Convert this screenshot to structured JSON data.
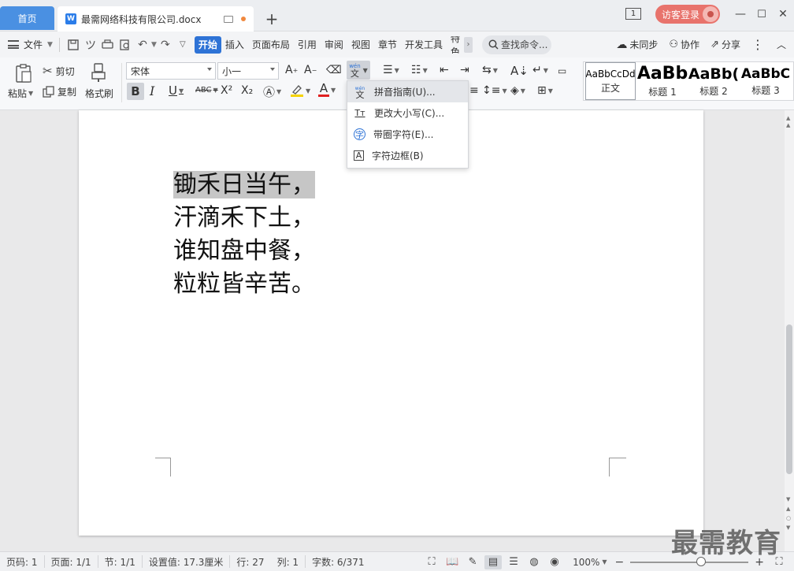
{
  "tabs": {
    "home": "首页",
    "doc_icon": "W",
    "doc_title": "最需网络科技有限公司.docx",
    "add": "+"
  },
  "titlebar": {
    "window_count": "1",
    "login": "访客登录",
    "minimize": "—",
    "maximize": "☐",
    "close": "✕"
  },
  "menubar": {
    "file": "文件",
    "items": [
      "开始",
      "插入",
      "页面布局",
      "引用",
      "审阅",
      "视图",
      "章节",
      "开发工具",
      "特色"
    ],
    "more": "›",
    "search": "查找命令...",
    "sync": "未同步",
    "collab": "协作",
    "share": "分享"
  },
  "ribbon": {
    "paste": "粘贴",
    "cut": "剪切",
    "copy": "复制",
    "format_painter": "格式刷",
    "font_name": "宋体",
    "font_size": "小一",
    "bold": "B",
    "italic": "I",
    "underline": "U",
    "strikethrough": "ABC",
    "superscript": "X²",
    "subscript": "X₂",
    "pinyin": "文"
  },
  "styles": [
    {
      "sample": "AaBbCcDd",
      "name": "正文"
    },
    {
      "sample": "AaBb",
      "name": "标题 1"
    },
    {
      "sample": "AaBb(",
      "name": "标题 2"
    },
    {
      "sample": "AaBbC",
      "name": "标题 3"
    }
  ],
  "dropdown": {
    "items": [
      {
        "label": "拼音指南(U)...",
        "icon": "文"
      },
      {
        "label": "更改大小写(C)...",
        "icon": "Tт"
      },
      {
        "label": "带圈字符(E)...",
        "icon": "字"
      },
      {
        "label": "字符边框(B)",
        "icon": "A"
      }
    ]
  },
  "document": {
    "lines": [
      "锄禾日当午，",
      "汗滴禾下土，",
      "谁知盘中餐，",
      "粒粒皆辛苦。"
    ]
  },
  "status": {
    "page": "页码: 1",
    "pages": "页面: 1/1",
    "section": "节: 1/1",
    "setting": "设置值: 17.3厘米",
    "row": "行: 27",
    "col": "列: 1",
    "words": "字数: 6/371",
    "zoom": "100%",
    "zoom_level_percent": 100
  },
  "watermark": "最需教育",
  "colors": {
    "accent": "#2e73d6",
    "home_tab": "#4a90e2",
    "login": "#e8736c"
  }
}
